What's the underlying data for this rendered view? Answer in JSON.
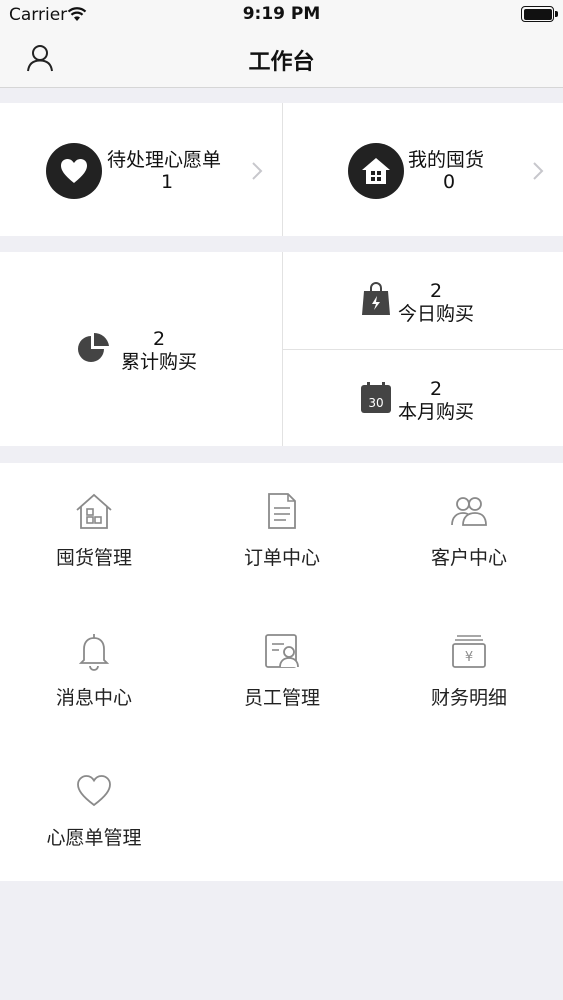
{
  "status_bar": {
    "carrier": "Carrier",
    "time": "9:19 PM"
  },
  "nav": {
    "title": "工作台"
  },
  "summary": [
    {
      "label": "待处理心愿单",
      "count": "1",
      "icon": "heart-icon"
    },
    {
      "label": "我的囤货",
      "count": "0",
      "icon": "house-icon"
    }
  ],
  "stats": {
    "total": {
      "value": "2",
      "label": "累计购买",
      "icon": "pie-chart-icon"
    },
    "today": {
      "value": "2",
      "label": "今日购买",
      "icon": "shopping-bag-icon"
    },
    "month": {
      "value": "2",
      "label": "本月购买",
      "icon": "calendar-icon",
      "calendar_day": "30"
    }
  },
  "grid": [
    {
      "label": "囤货管理",
      "icon": "warehouse-icon"
    },
    {
      "label": "订单中心",
      "icon": "document-icon"
    },
    {
      "label": "客户中心",
      "icon": "customers-icon"
    },
    {
      "label": "消息中心",
      "icon": "bell-icon"
    },
    {
      "label": "员工管理",
      "icon": "employee-card-icon"
    },
    {
      "label": "财务明细",
      "icon": "finance-icon"
    },
    {
      "label": "心愿单管理",
      "icon": "heart-outline-icon"
    }
  ],
  "colors": {
    "background": "#efeff4",
    "icon_dark": "#222222",
    "icon_gray": "#8a8a8a"
  }
}
